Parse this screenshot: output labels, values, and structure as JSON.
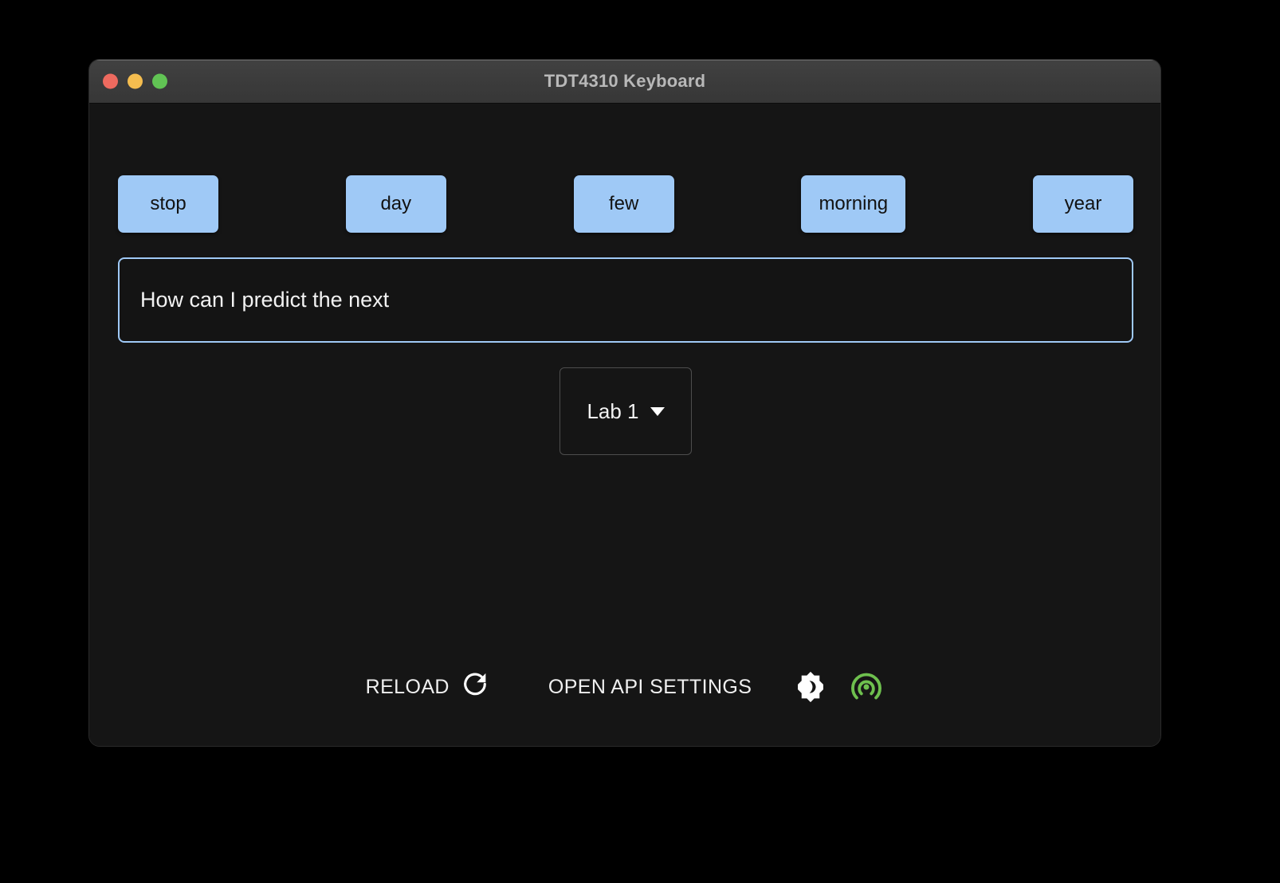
{
  "window": {
    "title": "TDT4310 Keyboard",
    "controls": {
      "close": "close-button",
      "minimize": "minimize-button",
      "maximize": "maximize-button"
    }
  },
  "suggestions": {
    "items": [
      {
        "label": "stop"
      },
      {
        "label": "day"
      },
      {
        "label": "few"
      },
      {
        "label": "morning"
      },
      {
        "label": "year"
      }
    ]
  },
  "text_field": {
    "value": "How can I predict the next",
    "placeholder": ""
  },
  "lab_selector": {
    "selected": "Lab 1",
    "caret": "chevron-down-icon"
  },
  "toolbar": {
    "reload_label": "RELOAD",
    "reload_icon": "refresh-icon",
    "api_settings_label": "OPEN API SETTINGS",
    "theme_toggle_icon": "brightness-dark-mode-icon",
    "broadcast_icon": "broadcast-icon"
  },
  "colors": {
    "suggestion_bg": "#9fc9f6",
    "suggestion_text": "#121212",
    "field_border": "#9fc9f6",
    "window_bg": "#151515",
    "titlebar_bg": "#3b3b3b",
    "title_text": "#b8b8b8",
    "broadcast_green": "#6ec04e",
    "traffic_close": "#ee6a5f",
    "traffic_min": "#f5bd4f",
    "traffic_max": "#61c454"
  }
}
